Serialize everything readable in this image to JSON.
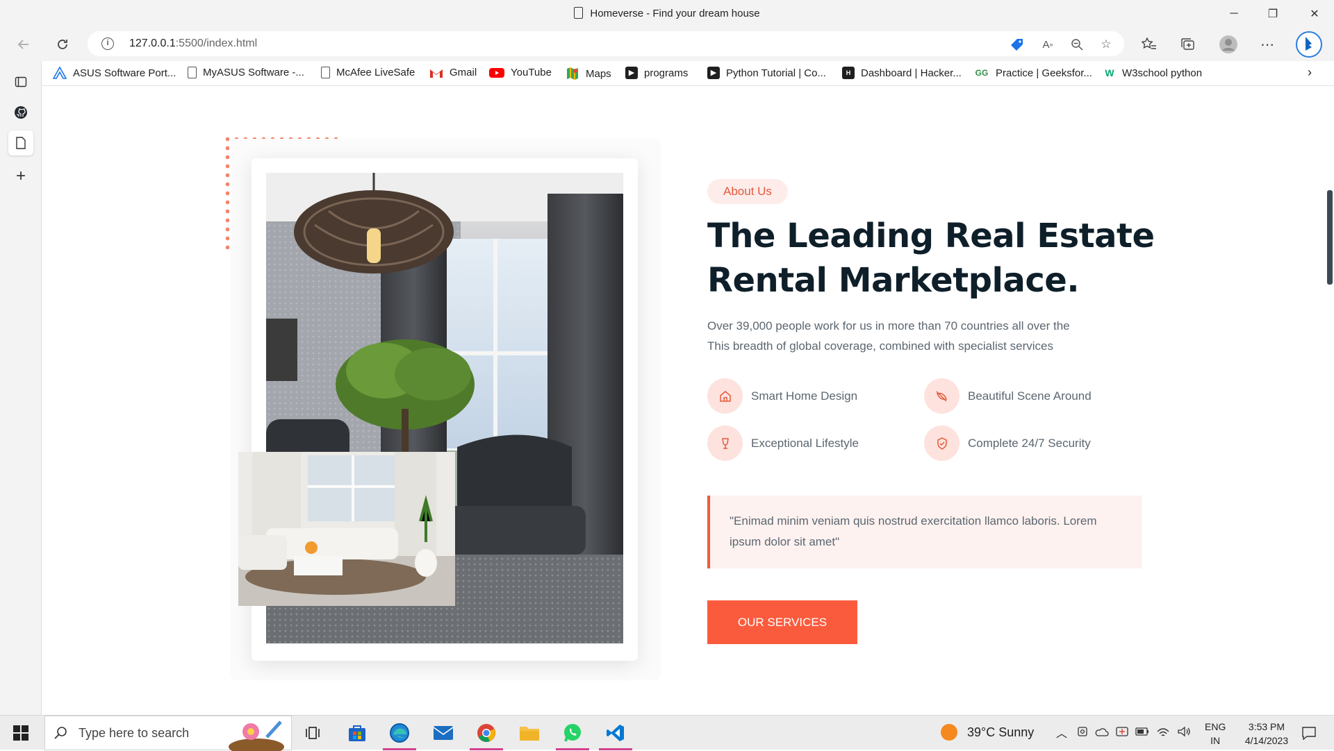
{
  "window": {
    "title": "Homeverse - Find your dream house",
    "controls": {
      "minimize": "─",
      "restore": "❐",
      "close": "✕"
    }
  },
  "address_bar": {
    "host": "127.0.0.1",
    "path": ":5500/index.html"
  },
  "favorites": [
    {
      "label": "ASUS Software Port...",
      "icon": "asus-icon",
      "color": "#1a73e8"
    },
    {
      "label": "MyASUS Software -...",
      "icon": "page-icon",
      "color": "#555555"
    },
    {
      "label": "McAfee LiveSafe",
      "icon": "page-icon",
      "color": "#555555"
    },
    {
      "label": "Gmail",
      "icon": "gmail-icon",
      "color": "#d93025"
    },
    {
      "label": "YouTube",
      "icon": "youtube-icon",
      "color": "#ff0000"
    },
    {
      "label": "Maps",
      "icon": "maps-icon",
      "color": "#34a853"
    },
    {
      "label": "programs",
      "icon": "hackerrank-icon",
      "color": "#1f1f1f"
    },
    {
      "label": "Python Tutorial | Co...",
      "icon": "hackerrank-icon",
      "color": "#1f1f1f"
    },
    {
      "label": "Dashboard | Hacker...",
      "icon": "hackerrank-icon",
      "color": "#1f1f1f"
    },
    {
      "label": "Practice | Geeksfor...",
      "icon": "geeksforgeeks-icon",
      "color": "#2f8d46"
    },
    {
      "label": "W3school python",
      "icon": "w3schools-icon",
      "color": "#04aa6d"
    }
  ],
  "about": {
    "badge": "About Us",
    "headline_line1": "The Leading Real Estate",
    "headline_line2": "Rental Marketplace.",
    "desc_line1": "Over 39,000 people work for us in more than 70 countries all over the",
    "desc_line2": "This breadth of global coverage, combined with specialist services",
    "features": [
      {
        "label": "Smart Home Design",
        "icon": "home-icon"
      },
      {
        "label": "Beautiful Scene Around",
        "icon": "leaf-icon"
      },
      {
        "label": "Exceptional Lifestyle",
        "icon": "wine-glass-icon"
      },
      {
        "label": "Complete 24/7 Security",
        "icon": "shield-icon"
      }
    ],
    "quote_line1": "\"Enimad minim veniam quis nostrud exercitation llamco laboris. Lorem",
    "quote_line2": "ipsum dolor sit amet\"",
    "cta": "OUR SERVICES",
    "accent": "#fb5b3d"
  },
  "taskbar": {
    "search_placeholder": "Type here to search",
    "weather": "39°C  Sunny",
    "lang_top": "ENG",
    "lang_bottom": "IN",
    "time": "3:53 PM",
    "date": "4/14/2023"
  }
}
